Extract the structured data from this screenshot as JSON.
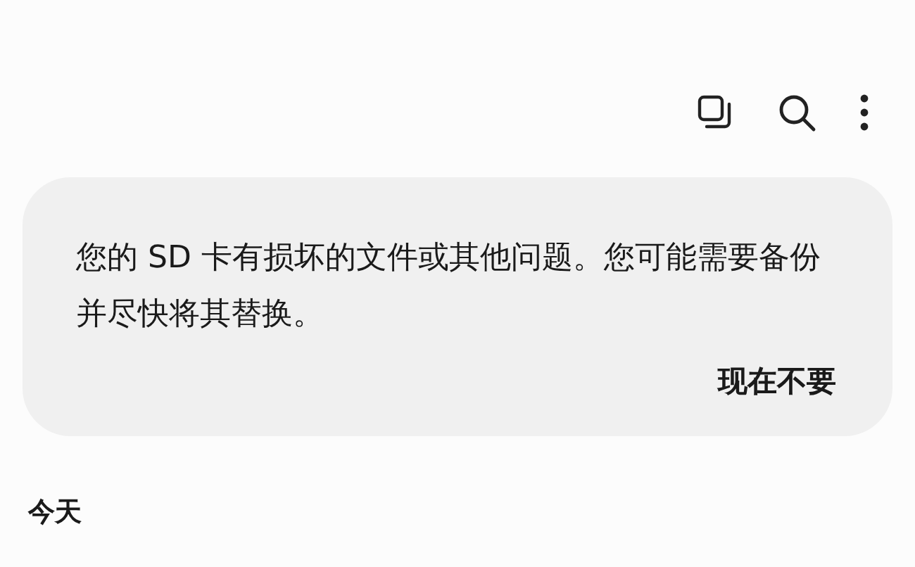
{
  "notice": {
    "message": "您的 SD 卡有损坏的文件或其他问题。您可能需要备份并尽快将其替换。",
    "action": "现在不要"
  },
  "section": {
    "title": "今天"
  }
}
